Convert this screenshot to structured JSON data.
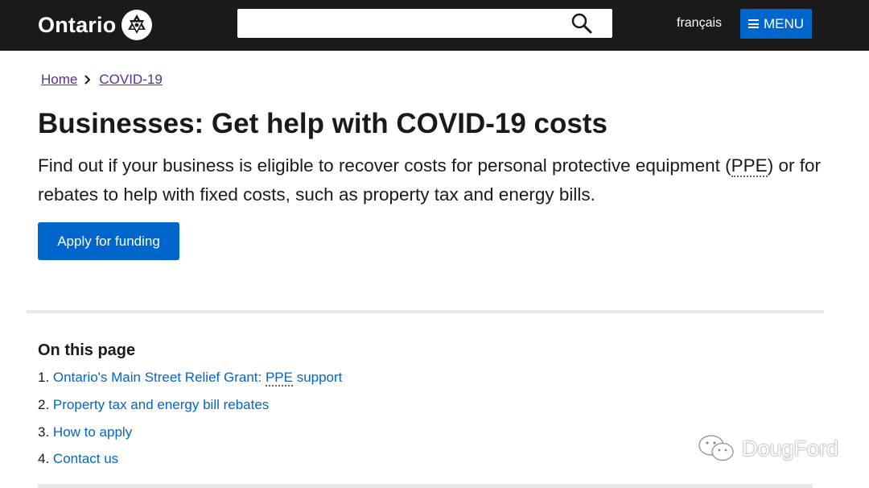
{
  "header": {
    "logo_text": "Ontario",
    "search_placeholder": "",
    "search_icon": "search-icon",
    "language_link": "français",
    "menu_label": "MENU",
    "menu_icon": "hamburger-icon"
  },
  "breadcrumb": {
    "items": [
      "Home",
      "COVID-19"
    ]
  },
  "main": {
    "title": "Businesses: Get help with COVID-19 costs",
    "lead_part1": "Find out if your business is eligible to recover costs for personal protective equipment (",
    "lead_abbr": "PPE",
    "lead_part2": ") or for rebates to help with fixed costs, such as property tax and energy bills.",
    "apply_button": "Apply for funding"
  },
  "on_this_page": {
    "title": "On this page",
    "items": [
      {
        "num": "1.",
        "pre": "Ontario's Main Street Relief Grant: ",
        "abbr": "PPE",
        "post": " support"
      },
      {
        "num": "2.",
        "label": "Property tax and energy bill rebates"
      },
      {
        "num": "3.",
        "label": "How to apply"
      },
      {
        "num": "4.",
        "label": "Contact us"
      }
    ]
  },
  "watermark": {
    "text": "DougFord",
    "icon": "wechat-icon"
  },
  "colors": {
    "header_bg": "#1a1a1a",
    "accent_blue": "#0066cc",
    "visited_link": "#5c2d91"
  }
}
